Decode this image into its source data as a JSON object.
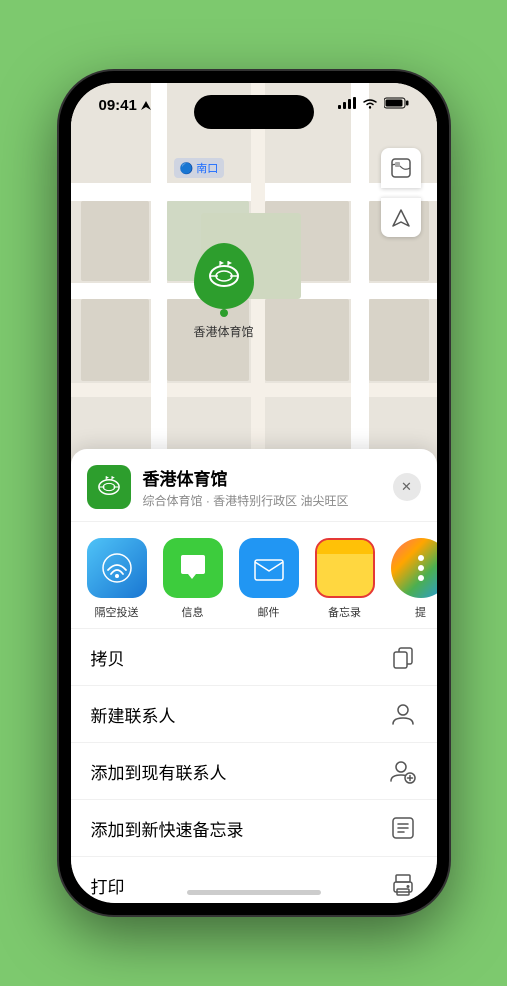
{
  "status_bar": {
    "time": "09:41",
    "navigation_arrow": "▶"
  },
  "map": {
    "location_label": "🔵 南口",
    "marker_label": "香港体育馆",
    "controls": {
      "map_type": "🗺",
      "location": "➤"
    }
  },
  "sheet": {
    "venue_name": "香港体育馆",
    "venue_sub": "综合体育馆 · 香港特别行政区 油尖旺区",
    "close_label": "✕"
  },
  "share_items": [
    {
      "id": "airdrop",
      "label": "隔空投送",
      "type": "airdrop"
    },
    {
      "id": "messages",
      "label": "信息",
      "type": "messages"
    },
    {
      "id": "mail",
      "label": "邮件",
      "type": "mail"
    },
    {
      "id": "notes",
      "label": "备忘录",
      "type": "notes"
    },
    {
      "id": "more",
      "label": "提",
      "type": "more"
    }
  ],
  "actions": [
    {
      "id": "copy",
      "label": "拷贝",
      "icon": "⎘"
    },
    {
      "id": "new-contact",
      "label": "新建联系人",
      "icon": "👤"
    },
    {
      "id": "add-existing",
      "label": "添加到现有联系人",
      "icon": "👤+"
    },
    {
      "id": "quick-note",
      "label": "添加到新快速备忘录",
      "icon": "📋"
    },
    {
      "id": "print",
      "label": "打印",
      "icon": "🖨"
    }
  ]
}
